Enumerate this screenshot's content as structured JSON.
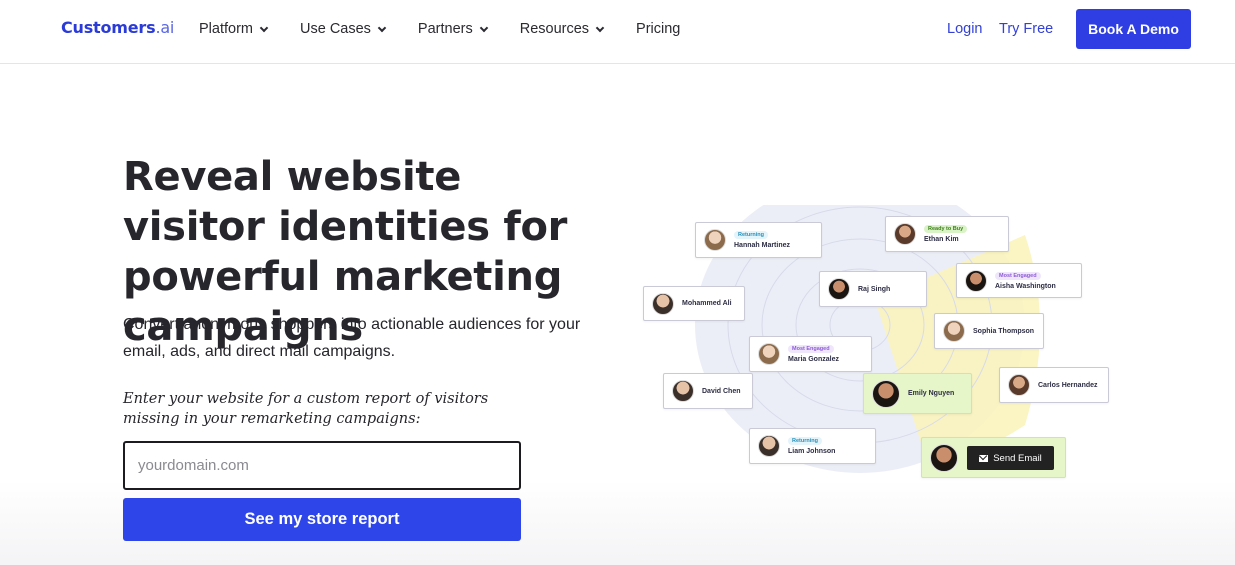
{
  "header": {
    "logo_main": "Customers",
    "logo_suffix": ".ai",
    "nav": [
      {
        "label": "Platform"
      },
      {
        "label": "Use Cases"
      },
      {
        "label": "Partners"
      },
      {
        "label": "Resources"
      },
      {
        "label": "Pricing"
      }
    ],
    "login": "Login",
    "try_free": "Try Free",
    "book_demo": "Book A Demo"
  },
  "hero": {
    "headline": "Reveal website visitor identities for powerful marketing campaigns",
    "subtext": "Convert anonymous shoppers into actionable audiences for your email, ads, and direct mail campaigns.",
    "prompt": "Enter your website for a custom report of visitors missing in your remarketing campaigns:",
    "input_placeholder": "yourdomain.com",
    "cta": "See my store report"
  },
  "illustration": {
    "cards": [
      {
        "name": "Hannah Martinez",
        "tag": "Returning"
      },
      {
        "name": "Ethan Kim",
        "tag": "Ready to Buy"
      },
      {
        "name": "Aisha Washington",
        "tag": "Most Engaged"
      },
      {
        "name": "Raj Singh"
      },
      {
        "name": "Mohammed Ali"
      },
      {
        "name": "Sophia Thompson"
      },
      {
        "name": "Maria Gonzalez",
        "tag": "Most Engaged"
      },
      {
        "name": "Emily Nguyen"
      },
      {
        "name": "Carlos Hernandez"
      },
      {
        "name": "David Chen"
      },
      {
        "name": "Liam Johnson",
        "tag": "Returning"
      }
    ],
    "send_email": "Send Email"
  }
}
